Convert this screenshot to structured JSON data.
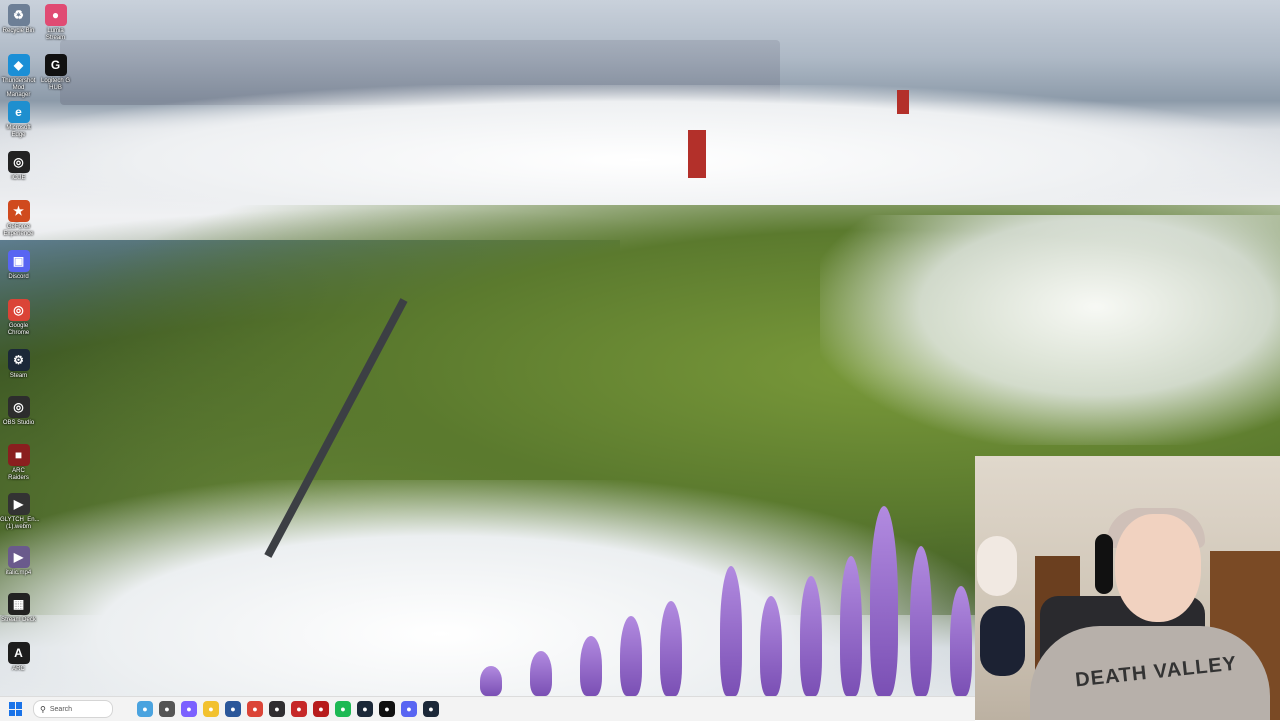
{
  "desktop_icons": [
    {
      "label": "Recycle Bin",
      "icon": "recycle-bin-icon"
    },
    {
      "label": "Lumia\nStream",
      "icon": "lumia-stream-icon"
    },
    {
      "label": "Thundershot\nMod Manager",
      "icon": "thunderstore-icon"
    },
    {
      "label": "Logitech G\nHUB",
      "icon": "logitech-ghub-icon"
    },
    {
      "label": "Microsoft\nEdge",
      "icon": "edge-icon"
    },
    {
      "label": "iCUE",
      "icon": "icue-icon"
    },
    {
      "label": "GeForce\nExperience",
      "icon": "geforce-experience-icon"
    },
    {
      "label": "Discord",
      "icon": "discord-icon"
    },
    {
      "label": "Google\nChrome",
      "icon": "chrome-icon"
    },
    {
      "label": "Steam",
      "icon": "steam-icon"
    },
    {
      "label": "OBS Studio",
      "icon": "obs-icon"
    },
    {
      "label": "ARC\nRaiders",
      "icon": "arc-raiders-icon"
    },
    {
      "label": "GLYTCH_En...\n(1).webm",
      "icon": "video-file-icon"
    },
    {
      "label": "italic.mp4",
      "icon": "mp4-file-icon"
    },
    {
      "label": "Stream Deck",
      "icon": "stream-deck-icon"
    },
    {
      "label": "ARC",
      "icon": "arc-icon"
    }
  ],
  "taskbar": {
    "search_placeholder": "Search",
    "apps": [
      {
        "name": "widgets",
        "icon": "widgets-icon",
        "color": "#4aa3df"
      },
      {
        "name": "task-view",
        "icon": "task-view-icon",
        "color": "#555555"
      },
      {
        "name": "copilot",
        "icon": "copilot-icon",
        "color": "#7b61ff"
      },
      {
        "name": "file-explorer",
        "icon": "folder-icon",
        "color": "#f2c12e"
      },
      {
        "name": "store",
        "icon": "store-icon",
        "color": "#2b579a"
      },
      {
        "name": "chrome",
        "icon": "chrome-icon",
        "color": "#db4437"
      },
      {
        "name": "obs",
        "icon": "obs-icon",
        "color": "#302e31"
      },
      {
        "name": "app-red",
        "icon": "app-icon",
        "color": "#c62828"
      },
      {
        "name": "adobe",
        "icon": "adobe-icon",
        "color": "#b71c1c"
      },
      {
        "name": "spotify",
        "icon": "spotify-icon",
        "color": "#1db954"
      },
      {
        "name": "steam",
        "icon": "steam-icon",
        "color": "#1b2838"
      },
      {
        "name": "logitech",
        "icon": "logitech-ghub-icon",
        "color": "#111111"
      },
      {
        "name": "discord",
        "icon": "discord-icon",
        "color": "#5865f2"
      },
      {
        "name": "steam-2",
        "icon": "steam-icon",
        "color": "#1b2838"
      }
    ]
  },
  "webcam": {
    "shirt_text": "DEATH VALLEY"
  }
}
